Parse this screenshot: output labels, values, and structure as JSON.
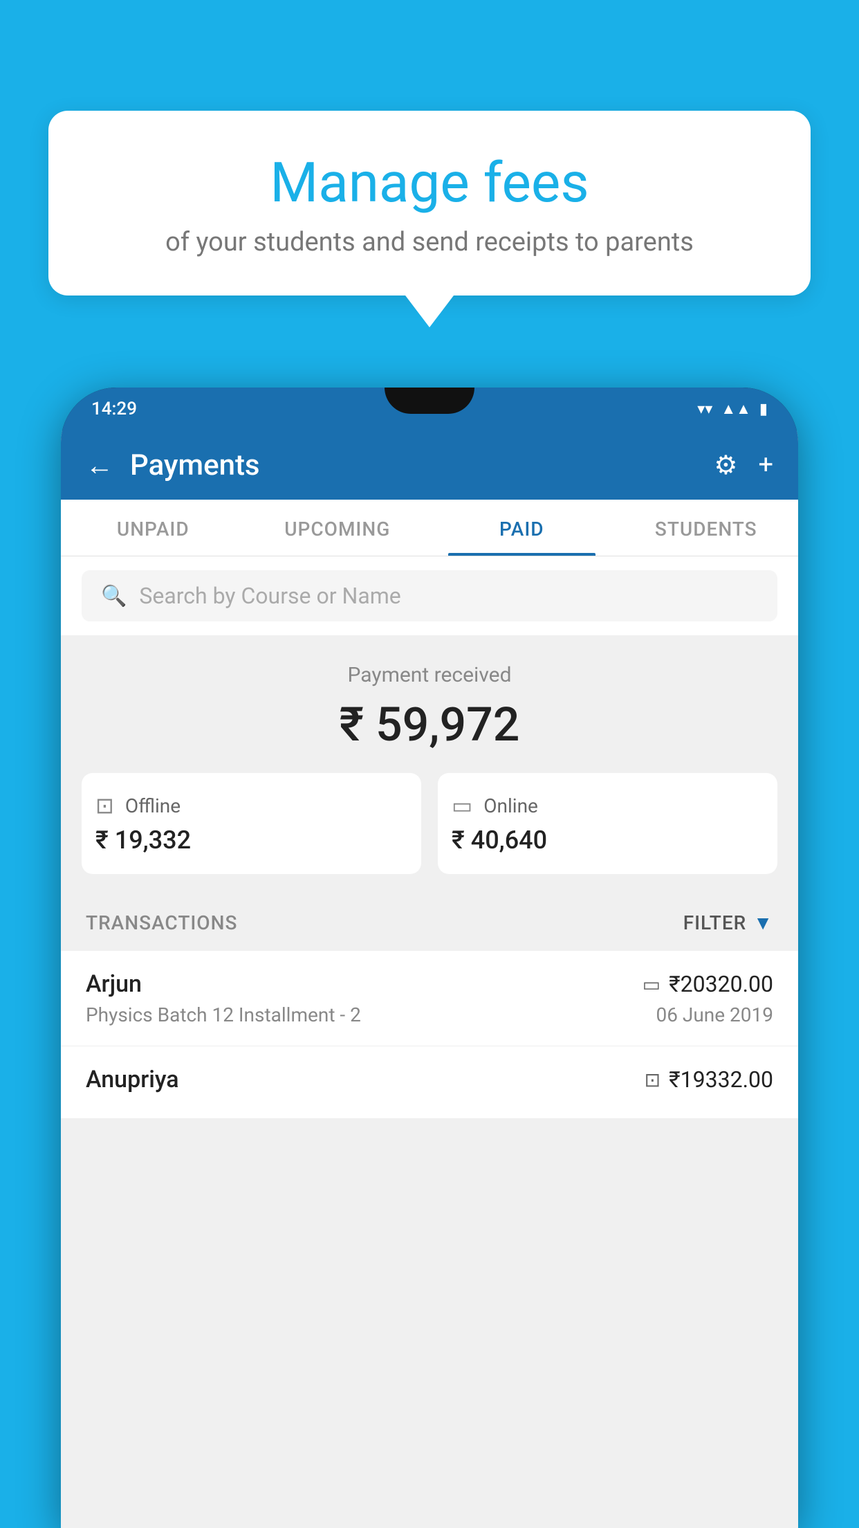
{
  "background_color": "#1ab0e8",
  "bubble": {
    "title": "Manage fees",
    "subtitle": "of your students and send receipts to parents"
  },
  "status_bar": {
    "time": "14:29",
    "icons": [
      "wifi",
      "signal",
      "battery"
    ]
  },
  "app_bar": {
    "title": "Payments",
    "back_label": "←",
    "settings_icon": "⚙",
    "add_icon": "+"
  },
  "tabs": [
    {
      "label": "UNPAID",
      "active": false
    },
    {
      "label": "UPCOMING",
      "active": false
    },
    {
      "label": "PAID",
      "active": true
    },
    {
      "label": "STUDENTS",
      "active": false
    }
  ],
  "search": {
    "placeholder": "Search by Course or Name"
  },
  "payment_summary": {
    "label": "Payment received",
    "amount": "₹ 59,972",
    "offline": {
      "icon": "💳",
      "label": "Offline",
      "amount": "₹ 19,332"
    },
    "online": {
      "icon": "💳",
      "label": "Online",
      "amount": "₹ 40,640"
    }
  },
  "transactions": {
    "section_label": "TRANSACTIONS",
    "filter_label": "FILTER",
    "items": [
      {
        "name": "Arjun",
        "course": "Physics Batch 12 Installment - 2",
        "amount": "₹20320.00",
        "date": "06 June 2019",
        "payment_type": "card"
      },
      {
        "name": "Anupriya",
        "course": "",
        "amount": "₹19332.00",
        "date": "",
        "payment_type": "cash"
      }
    ]
  }
}
